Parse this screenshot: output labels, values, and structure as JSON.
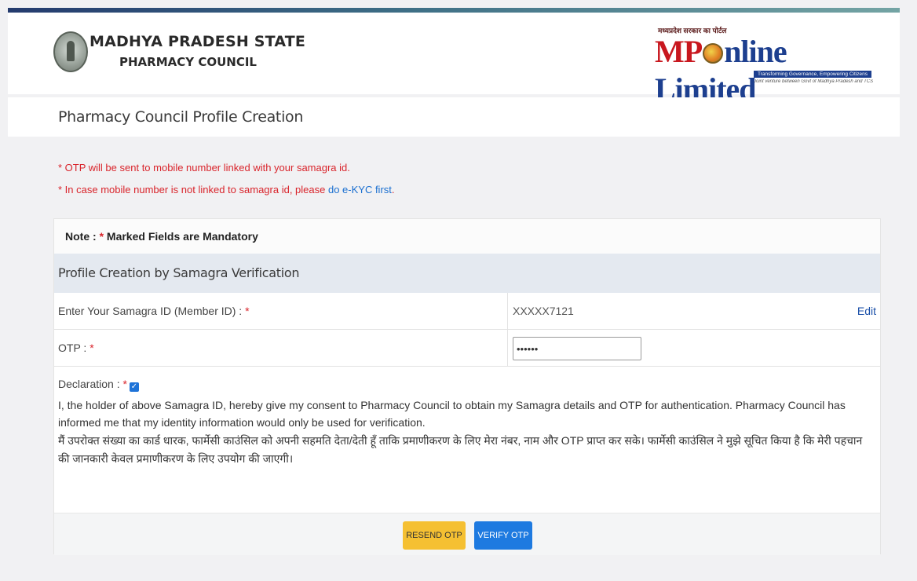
{
  "header": {
    "council_name_line1": "MADHYA PRADESH STATE",
    "council_name_line2": "PHARMACY COUNCIL",
    "mponline": {
      "hindi_tagline": "मध्यप्रदेश सरकार का पोर्टल",
      "word_mp": "MP",
      "word_online": "nline Limited",
      "strip_text": "Transforming Governance, Empowering Citizens",
      "subtext": "Joint venture between Govt of Madhya Pradesh and TCS"
    }
  },
  "page": {
    "title": "Pharmacy Council Profile Creation"
  },
  "info": {
    "line1": "* OTP will be sent to mobile number linked with your samagra id.",
    "line2_prefix": "* In case mobile number is not linked to samagra id, please ",
    "line2_link": "do e-KYC first",
    "line2_suffix": "."
  },
  "form": {
    "note_prefix": "Note : ",
    "note_star": "*",
    "note_suffix": " Marked Fields are Mandatory",
    "section_title": "Profile Creation by Samagra Verification",
    "samagra_label": "Enter Your Samagra ID (Member ID) : ",
    "samagra_value": "XXXXX7121",
    "edit_label": "Edit",
    "otp_label": "OTP : ",
    "otp_value": "••••••",
    "required_star": "*",
    "declaration_label": "Declaration : ",
    "declaration_checked": true,
    "declaration_english": "I, the holder of above Samagra ID, hereby give my consent to Pharmacy Council to obtain my Samagra details and OTP for authentication. Pharmacy Council has informed me that my identity information would only be used for verification.",
    "declaration_hindi": "मैं उपरोक्त संख्या का कार्ड धारक, फार्मेसी काउंसिल को अपनी सहमति देता/देती हूँ ताकि प्रमाणीकरण के लिए मेरा नंबर, नाम और OTP प्राप्त कर सके। फार्मेसी काउंसिल ने मुझे सूचित किया है कि मेरी पहचान की जानकारी केवल प्रमाणीकरण के लिए उपयोग की जाएगी।"
  },
  "buttons": {
    "resend": "RESEND OTP",
    "verify": "VERIFY OTP"
  },
  "colors": {
    "required": "#d9242b",
    "link": "#1a6fd0",
    "resend_bg": "#f5c032",
    "verify_bg": "#1e7ae0",
    "section_bg": "#e4e9f0"
  }
}
